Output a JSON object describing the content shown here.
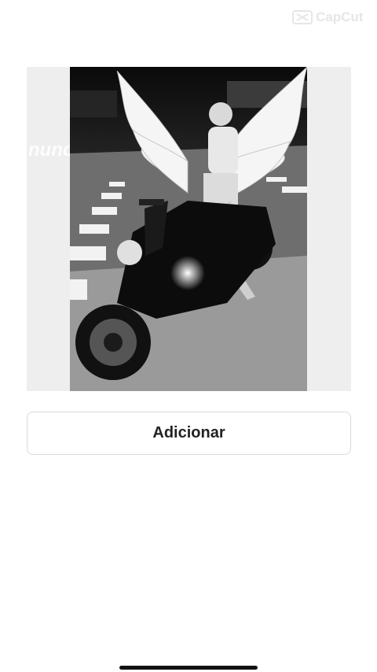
{
  "watermark": {
    "text": "CapCut",
    "icon": "capcut-logo-icon"
  },
  "media": {
    "description_icon": "photo-preview",
    "overlay_text": "nunca mais"
  },
  "actions": {
    "add_label": "Adicionar"
  },
  "colors": {
    "background": "#ffffff",
    "button_text": "#222222",
    "card_bg": "#eeeeee"
  }
}
